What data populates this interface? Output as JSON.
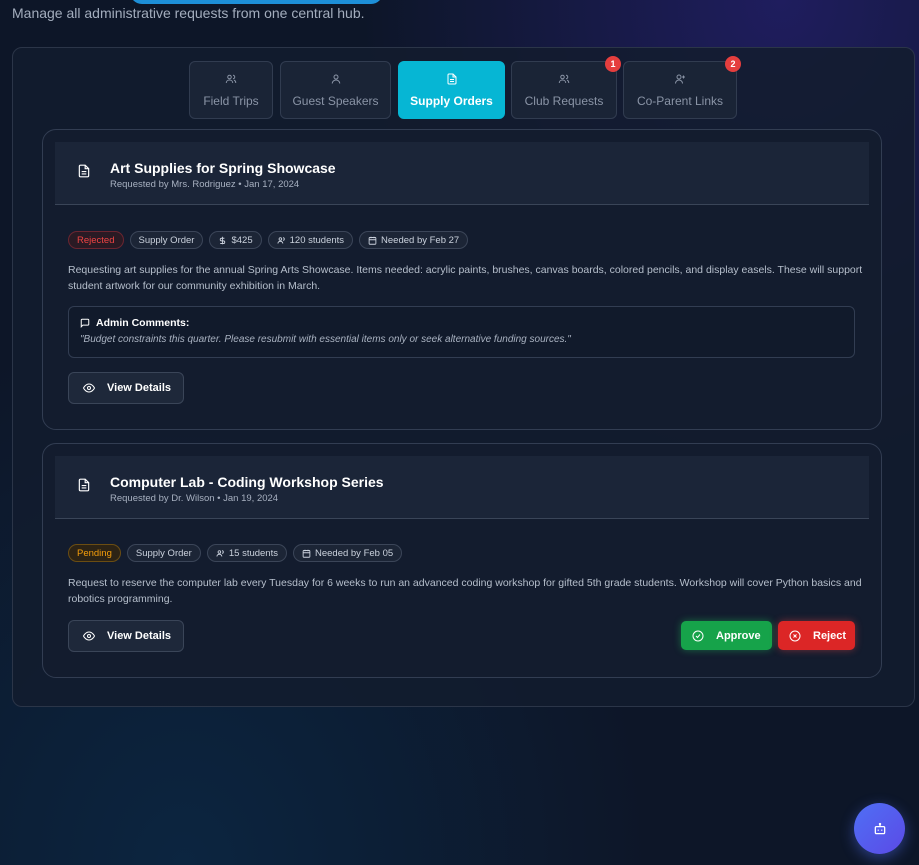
{
  "header": {
    "subtitle": "Manage all administrative requests from one central hub."
  },
  "tabs": [
    {
      "label": "Field Trips",
      "icon": "users-icon"
    },
    {
      "label": "Guest Speakers",
      "icon": "user-icon"
    },
    {
      "label": "Supply Orders",
      "icon": "file-icon",
      "active": true
    },
    {
      "label": "Club Requests",
      "icon": "users-icon",
      "badge": "1"
    },
    {
      "label": "Co-Parent Links",
      "icon": "user-plus-icon",
      "badge": "2"
    }
  ],
  "requests": [
    {
      "title": "Art Supplies for Spring Showcase",
      "meta": "Requested by Mrs. Rodriguez • Jan 17, 2024",
      "status": "Rejected",
      "type": "Supply Order",
      "cost": "$425",
      "students": "120 students",
      "needed_by": "Needed by Feb 27",
      "description": "Requesting art supplies for the annual Spring Arts Showcase. Items needed: acrylic paints, brushes, canvas boards, colored pencils, and display easels. These will support student artwork for our community exhibition in March.",
      "admin_comments_label": "Admin Comments:",
      "admin_comments": "\"Budget constraints this quarter. Please resubmit with essential items only or seek alternative funding sources.\"",
      "view_details_label": "View Details"
    },
    {
      "title": "Computer Lab - Coding Workshop Series",
      "meta": "Requested by Dr. Wilson • Jan 19, 2024",
      "status": "Pending",
      "type": "Supply Order",
      "students": "15 students",
      "needed_by": "Needed by Feb 05",
      "description": "Request to reserve the computer lab every Tuesday for 6 weeks to run an advanced coding workshop for gifted 5th grade students. Workshop will cover Python basics and robotics programming.",
      "view_details_label": "View Details",
      "approve_label": "Approve",
      "reject_label": "Reject"
    }
  ],
  "colors": {
    "accent": "#06b6d4",
    "rejected": "#ef4444",
    "pending": "#f59e0b",
    "approve": "#16a34a",
    "reject": "#dc2626"
  }
}
